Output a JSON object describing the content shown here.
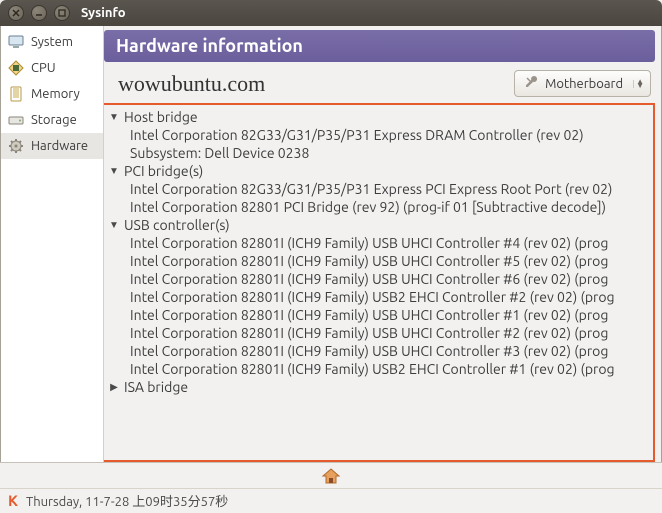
{
  "window": {
    "title": "Sysinfo"
  },
  "sidebar": {
    "items": [
      {
        "label": "System"
      },
      {
        "label": "CPU"
      },
      {
        "label": "Memory"
      },
      {
        "label": "Storage"
      },
      {
        "label": "Hardware"
      }
    ]
  },
  "header": {
    "title": "Hardware information"
  },
  "watermark": "wowubuntu.com",
  "combo": {
    "label": "Motherboard"
  },
  "tree": [
    {
      "label": "Host bridge",
      "expanded": true,
      "items": [
        "Intel Corporation 82G33/G31/P35/P31 Express DRAM Controller (rev 02)",
        "Subsystem: Dell Device 0238"
      ]
    },
    {
      "label": "PCI bridge(s)",
      "expanded": true,
      "items": [
        "Intel Corporation 82G33/G31/P35/P31 Express PCI Express Root Port (rev 02)",
        "Intel Corporation 82801 PCI Bridge (rev 92) (prog-if 01 [Subtractive decode])"
      ]
    },
    {
      "label": "USB controller(s)",
      "expanded": true,
      "items": [
        "Intel Corporation 82801I (ICH9 Family) USB UHCI Controller #4 (rev 02) (prog",
        "Intel Corporation 82801I (ICH9 Family) USB UHCI Controller #5 (rev 02) (prog",
        "Intel Corporation 82801I (ICH9 Family) USB UHCI Controller #6 (rev 02) (prog",
        "Intel Corporation 82801I (ICH9 Family) USB2 EHCI Controller #2 (rev 02) (prog",
        "Intel Corporation 82801I (ICH9 Family) USB UHCI Controller #1 (rev 02) (prog",
        "Intel Corporation 82801I (ICH9 Family) USB UHCI Controller #2 (rev 02) (prog",
        "Intel Corporation 82801I (ICH9 Family) USB UHCI Controller #3 (rev 02) (prog",
        "Intel Corporation 82801I (ICH9 Family) USB2 EHCI Controller #1 (rev 02) (prog"
      ]
    },
    {
      "label": "ISA bridge",
      "expanded": false,
      "items": []
    }
  ],
  "status": {
    "datetime": "Thursday, 11-7-28 上09时35分57秒"
  }
}
